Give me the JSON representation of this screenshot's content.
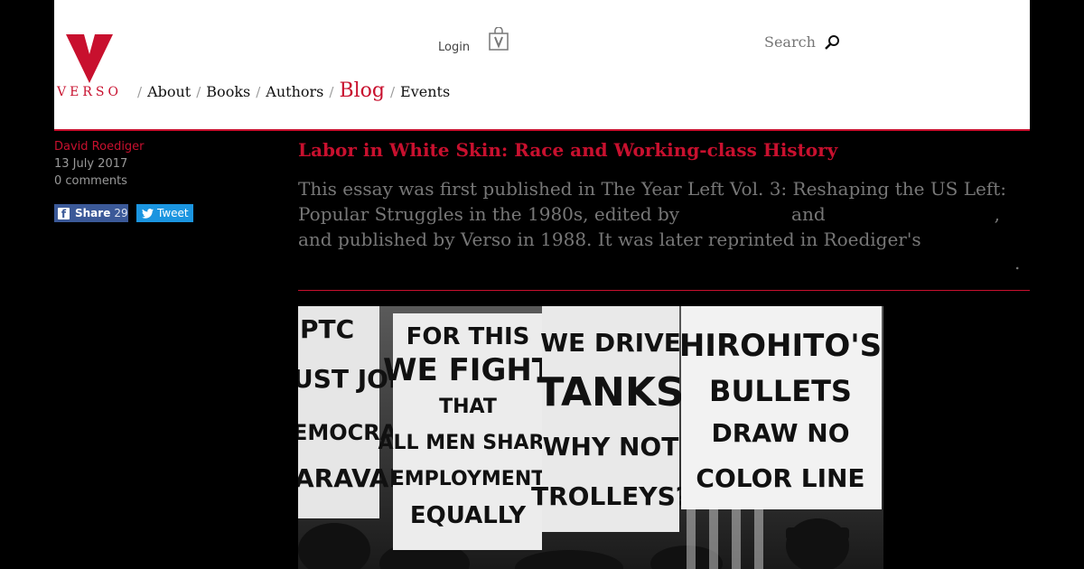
{
  "header": {
    "logo_word": "VERSO",
    "login_label": "Login",
    "search_placeholder": "Search",
    "nav": [
      {
        "label": "About"
      },
      {
        "label": "Books"
      },
      {
        "label": "Authors"
      },
      {
        "label": "Blog",
        "active": true
      },
      {
        "label": "Events"
      }
    ],
    "nav_separator": "/"
  },
  "meta": {
    "author": "David Roediger",
    "date": "13 July 2017",
    "comments": "0 comments",
    "share": {
      "icon_letter": "f",
      "label": "Share",
      "count": "29"
    },
    "tweet": {
      "label": "Tweet"
    }
  },
  "article": {
    "title": "Labor in White Skin: Race and Working-class History",
    "intro_lines": [
      "This essay was first published in The Year Left Vol. 3: Reshaping the US Left:",
      "Popular Struggles in the 1980s, edited by",
      "and",
      ",",
      "and published by Verso in 1988. It was later reprinted in Roediger's",
      "."
    ]
  },
  "photo": {
    "signs": [
      {
        "text_lines": [
          "PTC",
          "UST JOIN",
          "EMOCRACY'S",
          "ARAVAN"
        ]
      },
      {
        "text_lines": [
          "FOR THIS",
          "WE FIGHT",
          "THAT",
          "ALL MEN SHARE",
          "EMPLOYMENT",
          "EQUALLY"
        ]
      },
      {
        "text_lines": [
          "WE DRIVE",
          "TANKS",
          "WHY NOT",
          "TROLLEYS?"
        ]
      },
      {
        "text_lines": [
          "HIROHITO'S",
          "BULLETS",
          "DRAW NO",
          "COLOR LINE"
        ]
      }
    ]
  },
  "colors": {
    "accent": "#c8102e",
    "facebook": "#3b5998",
    "twitter": "#1b95e0"
  }
}
